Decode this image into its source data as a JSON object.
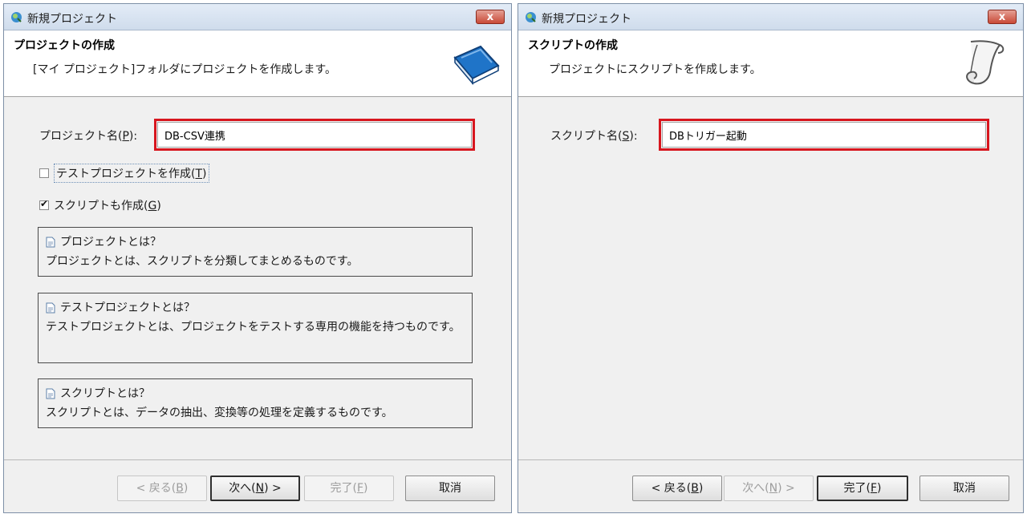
{
  "dialog1": {
    "title": "新規プロジェクト",
    "close_label": "x",
    "header_title": "プロジェクトの作成",
    "header_desc": "[マイ プロジェクト]フォルダにプロジェクトを作成します。",
    "header_icon": "book-icon",
    "project_name_label": "プロジェクト名(",
    "project_name_key": "P",
    "project_name_label_end": "):",
    "project_name_value": "DB-CSV連携",
    "test_project_checkbox": {
      "label": "テストプロジェクトを作成(",
      "key": "T",
      "end": ")",
      "checked": false
    },
    "script_checkbox": {
      "label": "スクリプトも作成(",
      "key": "G",
      "end": ")",
      "checked": true
    },
    "info_boxes": [
      {
        "heading": "プロジェクトとは？",
        "body": "プロジェクトとは、スクリプトを分類してまとめるものです。"
      },
      {
        "heading": "テストプロジェクトとは？",
        "body": "テストプロジェクトとは、プロジェクトをテストする専用の機能を持つものです。"
      },
      {
        "heading": "スクリプトとは？",
        "body": "スクリプトとは、データの抽出、変換等の処理を定義するものです。"
      }
    ],
    "buttons": {
      "back": {
        "label": "< 戻る(",
        "key": "B",
        "end": ")"
      },
      "next": {
        "label": "次へ(",
        "key": "N",
        "end": ") >"
      },
      "finish": {
        "label": "完了(",
        "key": "F",
        "end": ")"
      },
      "cancel": {
        "label": "取消"
      }
    }
  },
  "dialog2": {
    "title": "新規プロジェクト",
    "close_label": "x",
    "header_title": "スクリプトの作成",
    "header_desc": "プロジェクトにスクリプトを作成します。",
    "header_icon": "scroll-icon",
    "script_name_label": "スクリプト名(",
    "script_name_key": "S",
    "script_name_label_end": "):",
    "script_name_value": "DBトリガー起動",
    "buttons": {
      "back": {
        "label": "< 戻る(",
        "key": "B",
        "end": ")"
      },
      "next": {
        "label": "次へ(",
        "key": "N",
        "end": ") >"
      },
      "finish": {
        "label": "完了(",
        "key": "F",
        "end": ")"
      },
      "cancel": {
        "label": "取消"
      }
    }
  },
  "colors": {
    "highlight": "#d7161e",
    "dialog_bg": "#f0f0f0",
    "close_button": "#c94a37"
  }
}
